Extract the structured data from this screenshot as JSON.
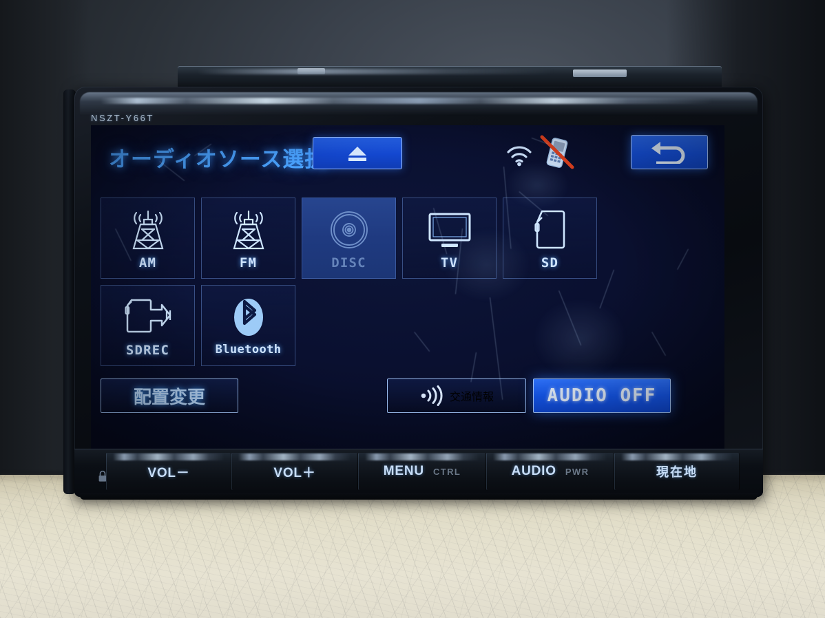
{
  "device": {
    "model_label": "NSZT-Y66T",
    "accent_blue": "#2a6bf2",
    "screen_bg": "#0a1030",
    "glow_blue": "#4aa2ff"
  },
  "screen": {
    "title": "オーディオソース選択",
    "eject": {
      "name": "eject-button",
      "glyph": "eject"
    },
    "back": {
      "name": "back-button",
      "glyph": "return-arrow"
    },
    "status": {
      "wifi": "wifi-icon",
      "phone_disconnected": "phone-disconnected-icon"
    },
    "sources": [
      {
        "label": "AM",
        "icon": "radio-tower-icon",
        "state": "enabled"
      },
      {
        "label": "FM",
        "icon": "radio-tower-icon",
        "state": "enabled"
      },
      {
        "label": "DISC",
        "icon": "disc-icon",
        "state": "disabled"
      },
      {
        "label": "TV",
        "icon": "television-icon",
        "state": "enabled"
      },
      {
        "label": "SD",
        "icon": "sd-card-icon",
        "state": "enabled"
      },
      {
        "label": "SDREC",
        "icon": "sd-record-icon",
        "state": "enabled"
      },
      {
        "label": "Bluetooth",
        "icon": "bluetooth-icon",
        "state": "enabled"
      }
    ],
    "bottom": {
      "rearrange": "配置変更",
      "traffic": "交通情報",
      "traffic_icon": "broadcast-wave-icon",
      "audio_off": "AUDIO OFF"
    }
  },
  "keys": [
    {
      "label": "VOL－",
      "sub": ""
    },
    {
      "label": "VOL＋",
      "sub": ""
    },
    {
      "label": "MENU",
      "sub": "CTRL"
    },
    {
      "label": "AUDIO",
      "sub": "PWR"
    },
    {
      "label": "現在地",
      "sub": ""
    }
  ],
  "lock_icon": "security-lock-icon"
}
